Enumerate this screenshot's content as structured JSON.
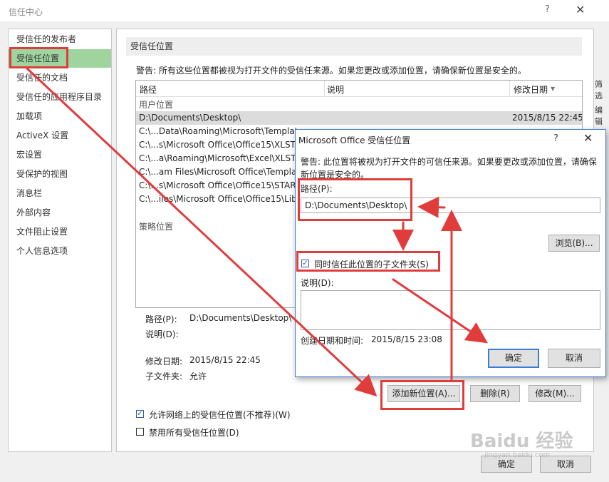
{
  "window": {
    "title": "信任中心",
    "help": "?",
    "close": "✕"
  },
  "sidebar": {
    "items": [
      {
        "label": "受信任的发布者"
      },
      {
        "label": "受信任位置"
      },
      {
        "label": "受信任的文档"
      },
      {
        "label": "受信任的应用程序目录"
      },
      {
        "label": "加载项"
      },
      {
        "label": "ActiveX 设置"
      },
      {
        "label": "宏设置"
      },
      {
        "label": "受保护的视图"
      },
      {
        "label": "消息栏"
      },
      {
        "label": "外部内容"
      },
      {
        "label": "文件阻止设置"
      },
      {
        "label": "个人信息选项"
      }
    ],
    "selected": "受信任位置"
  },
  "main": {
    "section_title": "受信任位置",
    "warning": "警告: 所有这些位置都被视为打开文件的受信任来源。如果您更改或添加位置，请确保新位置是安全的。",
    "columns": {
      "path": "路径",
      "description": "说明",
      "modified": "修改日期",
      "sort_icon": "▼"
    },
    "group_user": "用户位置",
    "group_policy": "策略位置",
    "rows": [
      {
        "path": "D:\\Documents\\Desktop\\",
        "date": "2015/8/15 22:45",
        "selected": true
      },
      {
        "path": "C:\\...Data\\Roaming\\Microsoft\\Templat",
        "date": ""
      },
      {
        "path": "C:\\...s\\Microsoft Office\\Office15\\XLSTA",
        "date": ""
      },
      {
        "path": "C:\\...a\\Roaming\\Microsoft\\Excel\\XLSTA",
        "date": ""
      },
      {
        "path": "C:\\...am Files\\Microsoft Office\\Templat",
        "date": ""
      },
      {
        "path": "C:\\...s\\Microsoft Office\\Office15\\START",
        "date": ""
      },
      {
        "path": "C:\\...iles\\Microsoft Office\\Office15\\Libr",
        "date": ""
      }
    ],
    "detail": {
      "path_label": "路径(P):",
      "path_value": "D:\\Documents\\Desktop\\",
      "desc_label": "说明(D):",
      "modified_label": "修改日期:",
      "modified_value": "2015/8/15 22:45",
      "subfolder_label": "子文件夹:",
      "subfolder_value": "允许"
    },
    "buttons": {
      "add": "添加新位置(A)...",
      "remove": "删除(R)",
      "modify": "修改(M)..."
    },
    "checkboxes": {
      "allow_network": {
        "label": "允许网络上的受信任位置(不推荐)(W)",
        "checked": true
      },
      "disable_all": {
        "label": "禁用所有受信任位置(D)",
        "checked": false
      }
    }
  },
  "footer": {
    "ok": "确定",
    "cancel": "取消"
  },
  "dialog": {
    "title": "Microsoft Office 受信任位置",
    "help": "?",
    "close": "✕",
    "warning": "警告: 此位置将被视为打开文件的可信任来源。如果要更改或添加位置，请确保新位置是安全的。",
    "path_label": "路径(P):",
    "path_value": "D:\\Documents\\Desktop\\",
    "browse": "浏览(B)...",
    "subfolder_checkbox": {
      "label": "同时信任此位置的子文件夹(S)",
      "checked": true
    },
    "desc_label": "说明(D):",
    "desc_value": "",
    "created_label": "创建日期和时间:",
    "created_value": "2015/8/15 23:08",
    "ok": "确定",
    "cancel": "取消"
  },
  "background_edge": {
    "t1": "筛选",
    "t2": "编辑"
  },
  "watermark": {
    "brand": "Baidu 经验",
    "url": "jingyan.baidu.com"
  },
  "colors": {
    "selected_sidebar": "#9fd49f",
    "annotation": "#e03c3c",
    "dialog_border": "#3b7dd8"
  }
}
